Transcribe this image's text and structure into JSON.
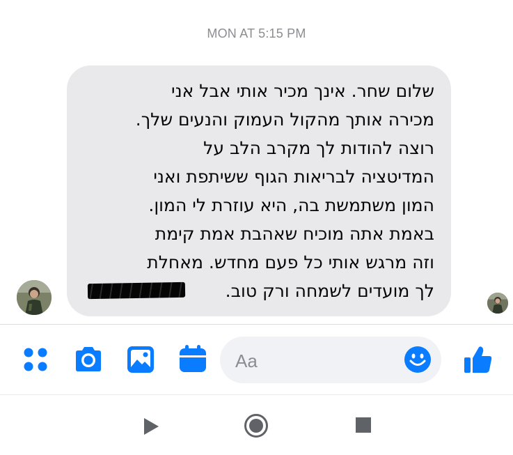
{
  "thread": {
    "timestamp": "MON AT 5:15 PM"
  },
  "message": {
    "text": "שלום שחר. אינך מכיר אותי אבל אני\nמכירה אותך מהקול העמוק והנעים שלך.\nרוצה להודות לך מקרב הלב על\nהמדיטציה לבריאות הגוף ששיתפת ואני\nהמון משתמשת בה, היא עוזרת לי המון.\nבאמת אתה מוכיח שאהבת אמת קימת\nוזה מרגש אותי כל פעם מחדש. מאחלת\nלך מועדים לשמחה ורק טוב.",
    "redacted_signature": true
  },
  "composer": {
    "placeholder": "Aa",
    "icons": [
      "more-apps-icon",
      "camera-icon",
      "gallery-icon",
      "calendar-icon",
      "emoji-icon",
      "thumbs-up-icon"
    ]
  },
  "navigation": {
    "icons": [
      "back-triangle-icon",
      "home-circle-icon",
      "recents-square-icon"
    ]
  },
  "colors": {
    "accent": "#0a7cff",
    "bubble": "#e9e9eb",
    "timestamp": "#8a8d91",
    "nav_icon": "#5f6368"
  }
}
